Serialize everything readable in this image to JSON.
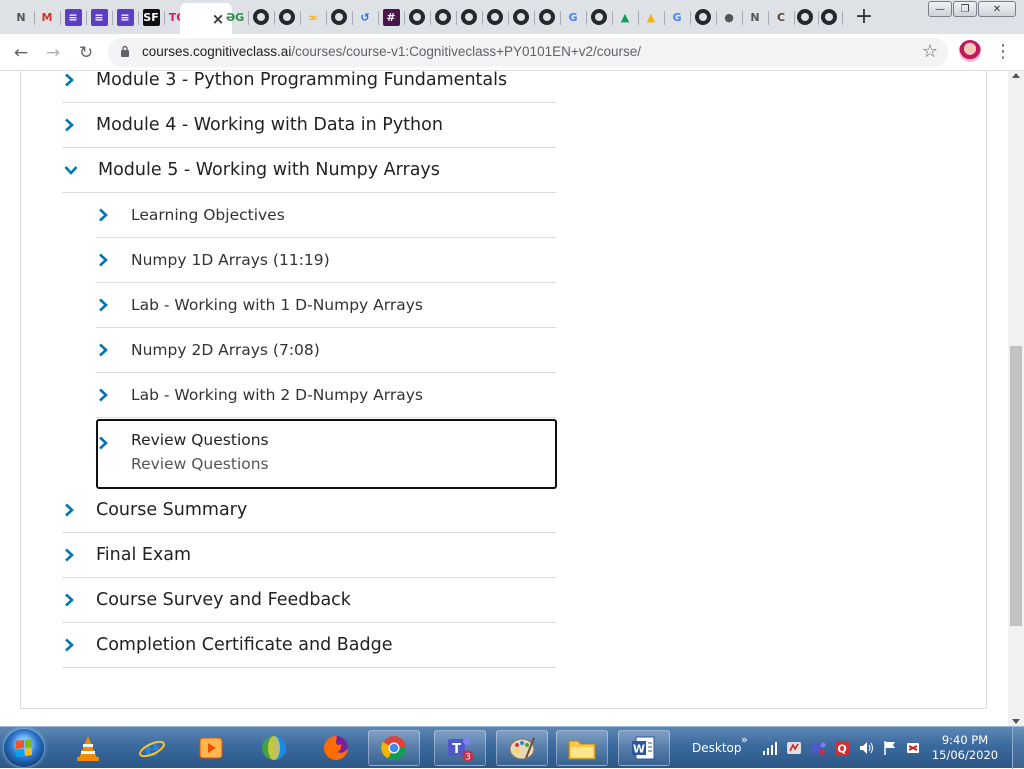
{
  "browser": {
    "tabs": [
      {
        "name": "notion-tab",
        "glyph": "N",
        "color": "#555555",
        "bg": "transparent"
      },
      {
        "name": "gmail-tab",
        "glyph": "M",
        "color": "#d93025",
        "bg": "transparent"
      },
      {
        "name": "list-tab-1",
        "glyph": "≡",
        "color": "#ffffff",
        "bg": "#5b3fbf"
      },
      {
        "name": "list-tab-2",
        "glyph": "≡",
        "color": "#ffffff",
        "bg": "#5b3fbf"
      },
      {
        "name": "list-tab-3",
        "glyph": "≡",
        "color": "#ffffff",
        "bg": "#5b3fbf"
      },
      {
        "name": "sf-tab",
        "glyph": "SF",
        "color": "#ffffff",
        "bg": "#111111"
      },
      {
        "name": "tg-tab",
        "glyph": "TG",
        "color": "#d81b60",
        "bg": "transparent"
      },
      {
        "name": "active-tab",
        "glyph": "×",
        "color": "#333333",
        "bg": "transparent",
        "active": true
      },
      {
        "name": "gfg-tab",
        "glyph": "ƏG",
        "color": "#2f8d46",
        "bg": "transparent"
      },
      {
        "name": "github-tab-1",
        "glyph": "gh"
      },
      {
        "name": "github-tab-2",
        "glyph": "gh"
      },
      {
        "name": "colab-tab",
        "glyph": "∞",
        "color": "#f9ab00",
        "bg": "transparent"
      },
      {
        "name": "github-tab-3",
        "glyph": "gh"
      },
      {
        "name": "history-tab",
        "glyph": "↺",
        "color": "#1a73e8",
        "bg": "transparent"
      },
      {
        "name": "slack-tab",
        "glyph": "#",
        "color": "#ffffff",
        "bg": "#4a154b"
      },
      {
        "name": "github-tab-4",
        "glyph": "gh"
      },
      {
        "name": "github-tab-5",
        "glyph": "gh"
      },
      {
        "name": "github-tab-6",
        "glyph": "gh"
      },
      {
        "name": "github-tab-7",
        "glyph": "gh"
      },
      {
        "name": "github-tab-8",
        "glyph": "gh"
      },
      {
        "name": "github-tab-9",
        "glyph": "gh"
      },
      {
        "name": "google-tab-1",
        "glyph": "G",
        "color": "#4285f4",
        "bg": "transparent"
      },
      {
        "name": "github-tab-10",
        "glyph": "gh"
      },
      {
        "name": "drive-tab-1",
        "glyph": "▲",
        "color": "#0f9d58",
        "bg": "transparent"
      },
      {
        "name": "drive-tab-2",
        "glyph": "▲",
        "color": "#f4b400",
        "bg": "transparent"
      },
      {
        "name": "google-tab-2",
        "glyph": "G",
        "color": "#4285f4",
        "bg": "transparent"
      },
      {
        "name": "github-tab-11",
        "glyph": "gh"
      },
      {
        "name": "globe-tab",
        "glyph": "●",
        "color": "#555555",
        "bg": "transparent"
      },
      {
        "name": "notion-tab-2",
        "glyph": "N",
        "color": "#555555",
        "bg": "transparent"
      },
      {
        "name": "codechef-tab",
        "glyph": "C",
        "color": "#5b4638",
        "bg": "transparent"
      },
      {
        "name": "github-tab-12",
        "glyph": "gh"
      },
      {
        "name": "github-tab-13",
        "glyph": "gh"
      }
    ],
    "new_tab": "+",
    "url_host": "courses.cognitiveclass.ai",
    "url_path": "/courses/course-v1:Cognitiveclass+PY0101EN+v2/course/",
    "star": "☆",
    "kebab": "⋮"
  },
  "outline": {
    "modules_before": [
      {
        "label": "Module 3 - Python Programming Fundamentals"
      },
      {
        "label": "Module 4 - Working with Data in Python"
      }
    ],
    "expanded_module": {
      "label": "Module 5 - Working with Numpy Arrays"
    },
    "subsections": [
      {
        "label": "Learning Objectives"
      },
      {
        "label": "Numpy 1D Arrays (11:19)"
      },
      {
        "label": "Lab - Working with 1 D-Numpy Arrays"
      },
      {
        "label": "Numpy 2D Arrays (7:08)"
      },
      {
        "label": "Lab - Working with 2 D-Numpy Arrays"
      }
    ],
    "focused": {
      "label": "Review Questions",
      "sublabel": "Review Questions"
    },
    "modules_after": [
      {
        "label": "Course Summary"
      },
      {
        "label": "Final Exam"
      },
      {
        "label": "Course Survey and Feedback"
      },
      {
        "label": "Completion Certificate and Badge"
      }
    ],
    "chevron_color": "#0075b4"
  },
  "taskbar": {
    "desktop_label": "Desktop",
    "overflow": "»",
    "time": "9:40 PM",
    "date": "15/06/2020",
    "teams_badge": "3"
  }
}
